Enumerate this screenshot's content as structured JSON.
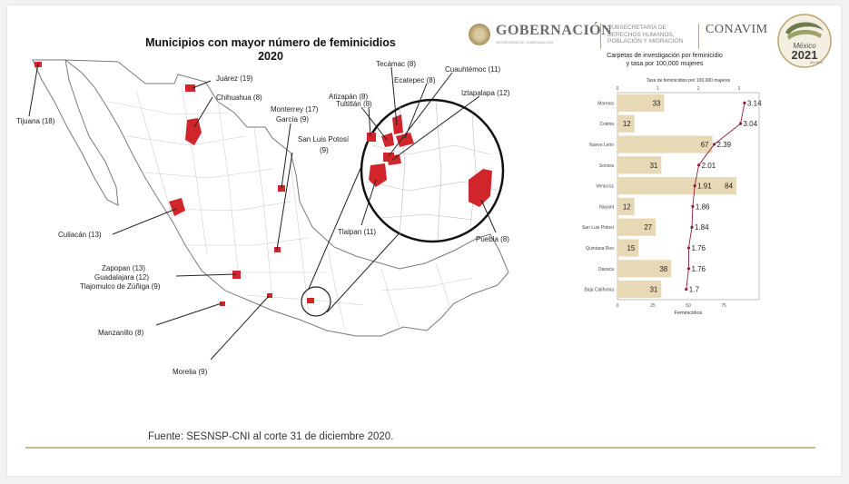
{
  "map": {
    "title_line1": "Municipios con mayor número de feminicidios",
    "title_line2": "2020",
    "labels": {
      "tijuana": "Tijuana (18)",
      "juarez": "Juárez (19)",
      "chihuahua": "Chihuahua (8)",
      "monterrey": "Monterrey (17)",
      "garcia": "García (9)",
      "slp_line1": "San Luis Potosí",
      "slp_line2": "(9)",
      "culiacan": "Culiacán (13)",
      "zapopan": "Zapopan (13)",
      "guadalajara": "Guadalajara (12)",
      "tlajomulco": "Tlajomulco de Zúñiga (9)",
      "manzanillo": "Manzanillo (8)",
      "morelia": "Morelia (9)",
      "tultitlan": "Tultitlán (8)",
      "tecamac": "Tecámac (8)",
      "cuauhtemoc": "Cuauhtémoc (11)",
      "atizapan": "Atizapán (8)",
      "ecatepec": "Ecatepec (8)",
      "iztapalapa": "Iztapalapa (12)",
      "tlalpan": "Tlalpan (11)",
      "puebla": "Puebla (8)"
    },
    "highlight_color": "#d0262b"
  },
  "header": {
    "gobernacion": "GOBERNACIÓN",
    "gobernacion_sub": "SECRETARÍA DE GOBERNACIÓN",
    "subsecretaria": "SUBSECRETARÍA DE DERECHOS HUMANOS, POBLACIÓN Y MIGRACIÓN",
    "conavim": "CONAVIM",
    "badge_text": "México 2021",
    "badge_sub": "año de la"
  },
  "footer": {
    "source": "Fuente: SESNSP-CNI al corte 31 de diciembre 2020."
  },
  "chart_data": {
    "type": "bar",
    "title_line1": "Carpetas de investigación por feminicidio",
    "title_line2": "y tasa por 100,000 mujeres",
    "categories": [
      "Morelos",
      "Colima",
      "Nuevo León",
      "Sonora",
      "Veracruz",
      "Nayarit",
      "San Luis Potosí",
      "Quintana Roo",
      "Oaxaca",
      "Baja California"
    ],
    "series": [
      {
        "name": "Feminicidios",
        "type": "bar",
        "values": [
          33,
          12,
          67,
          31,
          84,
          12,
          27,
          15,
          38,
          31
        ]
      },
      {
        "name": "Tasa de feminicidios por 100,000 mujeres",
        "type": "line",
        "values": [
          3.14,
          3.04,
          2.39,
          2.01,
          1.91,
          1.86,
          1.84,
          1.76,
          1.76,
          1.7
        ]
      }
    ],
    "xlabel": "Feminicidios",
    "x2label": "Tasa de feminicidios por 100,000 mujeres",
    "xlim": [
      0,
      100
    ],
    "xticks": [
      0,
      25,
      50,
      75
    ],
    "x2lim": [
      0,
      3.5
    ],
    "x2ticks": [
      0,
      1,
      2,
      3
    ],
    "bar_color": "#e8d9b6",
    "line_color": "#8e1e3c"
  }
}
